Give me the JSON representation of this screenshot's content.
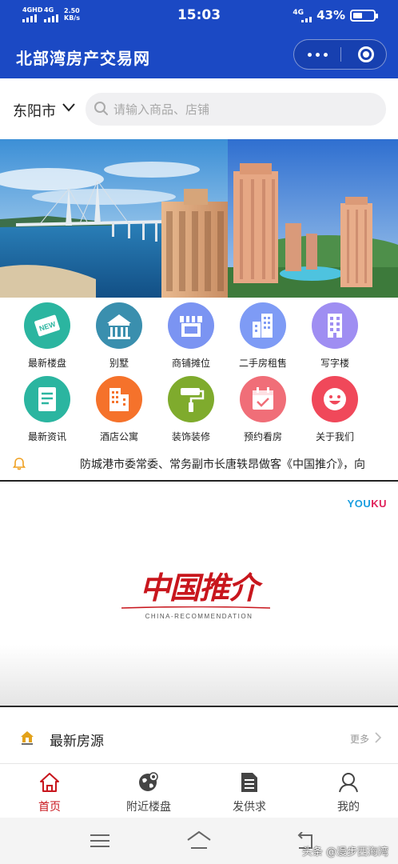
{
  "status_bar": {
    "left_signal_1": "4GHD",
    "left_signal_2": "4G",
    "speed_value": "2.50",
    "speed_unit": "KB/s",
    "time": "15:03",
    "right_signal": "4G",
    "battery": "43%",
    "battery_level": 0.43
  },
  "app_bar": {
    "title": "北部湾房产交易网",
    "more_icon": "more-dots-icon",
    "close_icon": "target-circle-icon"
  },
  "location": {
    "city": "东阳市"
  },
  "search": {
    "placeholder": "请输入商品、店铺"
  },
  "categories": [
    {
      "label": "最新楼盘",
      "icon": "new-badge-icon",
      "color": "#2bb5a0"
    },
    {
      "label": "别墅",
      "icon": "villa-icon",
      "color": "#3a8fae"
    },
    {
      "label": "商铺摊位",
      "icon": "shop-icon",
      "color": "#7b94f2"
    },
    {
      "label": "二手房租售",
      "icon": "buildings-icon",
      "color": "#7e9bf5"
    },
    {
      "label": "写字楼",
      "icon": "office-icon",
      "color": "#9f8ef2"
    },
    {
      "label": "最新资讯",
      "icon": "document-icon",
      "color": "#2bb5a0"
    },
    {
      "label": "酒店公寓",
      "icon": "hotel-icon",
      "color": "#f5722b"
    },
    {
      "label": "装饰装修",
      "icon": "paint-roller-icon",
      "color": "#7fab2d"
    },
    {
      "label": "预约看房",
      "icon": "calendar-icon",
      "color": "#f06e78"
    },
    {
      "label": "关于我们",
      "icon": "smile-icon",
      "color": "#f0485a"
    }
  ],
  "notice": {
    "text": "防城港市委常委、常务副市长唐轶昂做客《中国推介》，向"
  },
  "video": {
    "youku": "YOUKU",
    "logo_cn": "中国推介",
    "logo_en": "CHINA-RECOMMENDATION"
  },
  "section": {
    "title": "最新房源",
    "more": "更多"
  },
  "tabs": [
    {
      "label": "首页",
      "icon": "home-icon",
      "active": true
    },
    {
      "label": "附近楼盘",
      "icon": "globe-pin-icon",
      "active": false
    },
    {
      "label": "发供求",
      "icon": "document-list-icon",
      "active": false
    },
    {
      "label": "我的",
      "icon": "user-icon",
      "active": false
    }
  ],
  "watermark": "头条 @漫步西海湾",
  "colors": {
    "brand_blue": "#1b49c4",
    "accent_red": "#c8161d"
  }
}
